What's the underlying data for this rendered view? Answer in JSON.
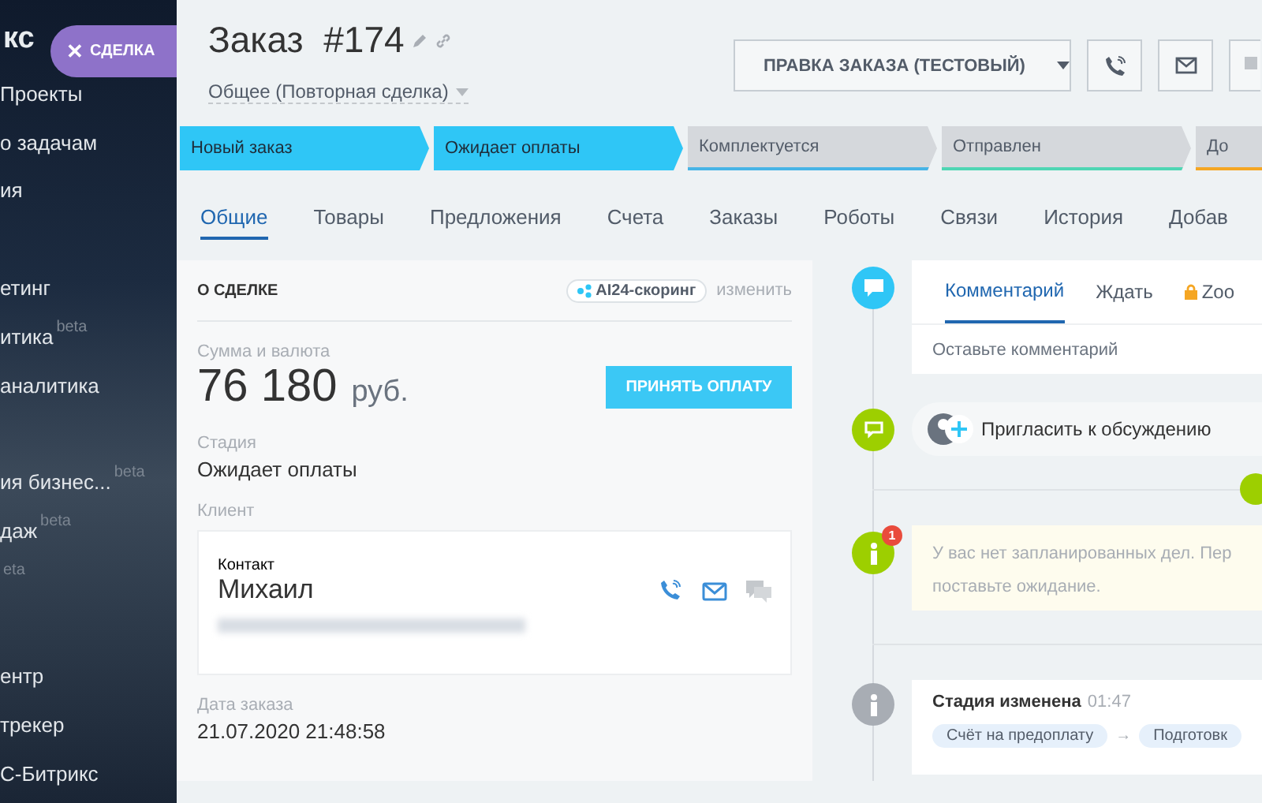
{
  "sidebar": {
    "logo": {
      "text": "кс"
    },
    "items": [
      {
        "label": "Проекты",
        "spaced": false
      },
      {
        "label": "о задачам",
        "spaced": false
      },
      {
        "label": "ия",
        "spaced": false
      },
      {
        "label": "етинг",
        "spaced": true
      },
      {
        "label": "итика",
        "beta": "beta",
        "spaced": false
      },
      {
        "label": "аналитика",
        "spaced": false
      },
      {
        "label": "ия бизнес...",
        "beta": "beta",
        "spaced": true
      },
      {
        "label": "даж",
        "beta": "beta",
        "spaced": false
      },
      {
        "beta": "eta",
        "spaced": false
      },
      {
        "label": "ентр",
        "spaced": true
      },
      {
        "label": "трекер",
        "spaced": false
      },
      {
        "label": "С-Битрикс",
        "spaced": false
      }
    ]
  },
  "close_pill": {
    "label": "СДЕЛКА",
    "close": "✕"
  },
  "header": {
    "title": "Заказ  #174",
    "category": "Общее (Повторная сделка)",
    "main_button": "ПРАВКА ЗАКАЗА (ТЕСТОВЫЙ)"
  },
  "stages": [
    {
      "label": "Новый заказ",
      "reached": true,
      "color": "#2fc6f6"
    },
    {
      "label": "Ожидает оплаты",
      "reached": true,
      "color": "#2fc6f6"
    },
    {
      "label": "Комплектуется",
      "reached": false,
      "color": "#47b4e6"
    },
    {
      "label": "Отправлен",
      "reached": false,
      "color": "#4fd6b4"
    },
    {
      "label": "До",
      "reached": false,
      "color": "#f5a623"
    }
  ],
  "tabs": [
    {
      "label": "Общие",
      "selected": true
    },
    {
      "label": "Товары",
      "selected": false
    },
    {
      "label": "Предложения",
      "selected": false
    },
    {
      "label": "Счета",
      "selected": false
    },
    {
      "label": "Заказы",
      "selected": false
    },
    {
      "label": "Роботы",
      "selected": false
    },
    {
      "label": "Связи",
      "selected": false
    },
    {
      "label": "История",
      "selected": false
    },
    {
      "label": "Добав",
      "selected": false
    }
  ],
  "deal_card": {
    "title": "О СДЕЛКЕ",
    "scoring": "AI24-скоринг",
    "edit": "изменить",
    "amount_label": "Сумма и валюта",
    "amount": "76 180",
    "currency": "руб.",
    "pay_button": "ПРИНЯТЬ ОПЛАТУ",
    "stage_label": "Стадия",
    "stage": "Ожидает оплаты",
    "client_label": "Клиент",
    "contact": {
      "label": "Контакт",
      "name": "Михаил"
    },
    "date_label": "Дата заказа",
    "date": "21.07.2020 21:48:58"
  },
  "timeline": {
    "composer": {
      "tabs": [
        {
          "label": "Комментарий",
          "selected": true,
          "locked": false
        },
        {
          "label": "Ждать",
          "selected": false,
          "locked": false
        },
        {
          "label": "Zoo",
          "selected": false,
          "locked": true
        }
      ],
      "placeholder": "Оставьте комментарий"
    },
    "invite": "Пригласить к обсуждению",
    "notice": {
      "badge": "1",
      "lines": [
        "У вас нет запланированных дел. Пер",
        "поставьте ожидание."
      ]
    },
    "event": {
      "title": "Стадия изменена",
      "time": "01:47",
      "from": "Счёт на предоплату",
      "arrow": "→",
      "to": "Подготовк"
    }
  }
}
